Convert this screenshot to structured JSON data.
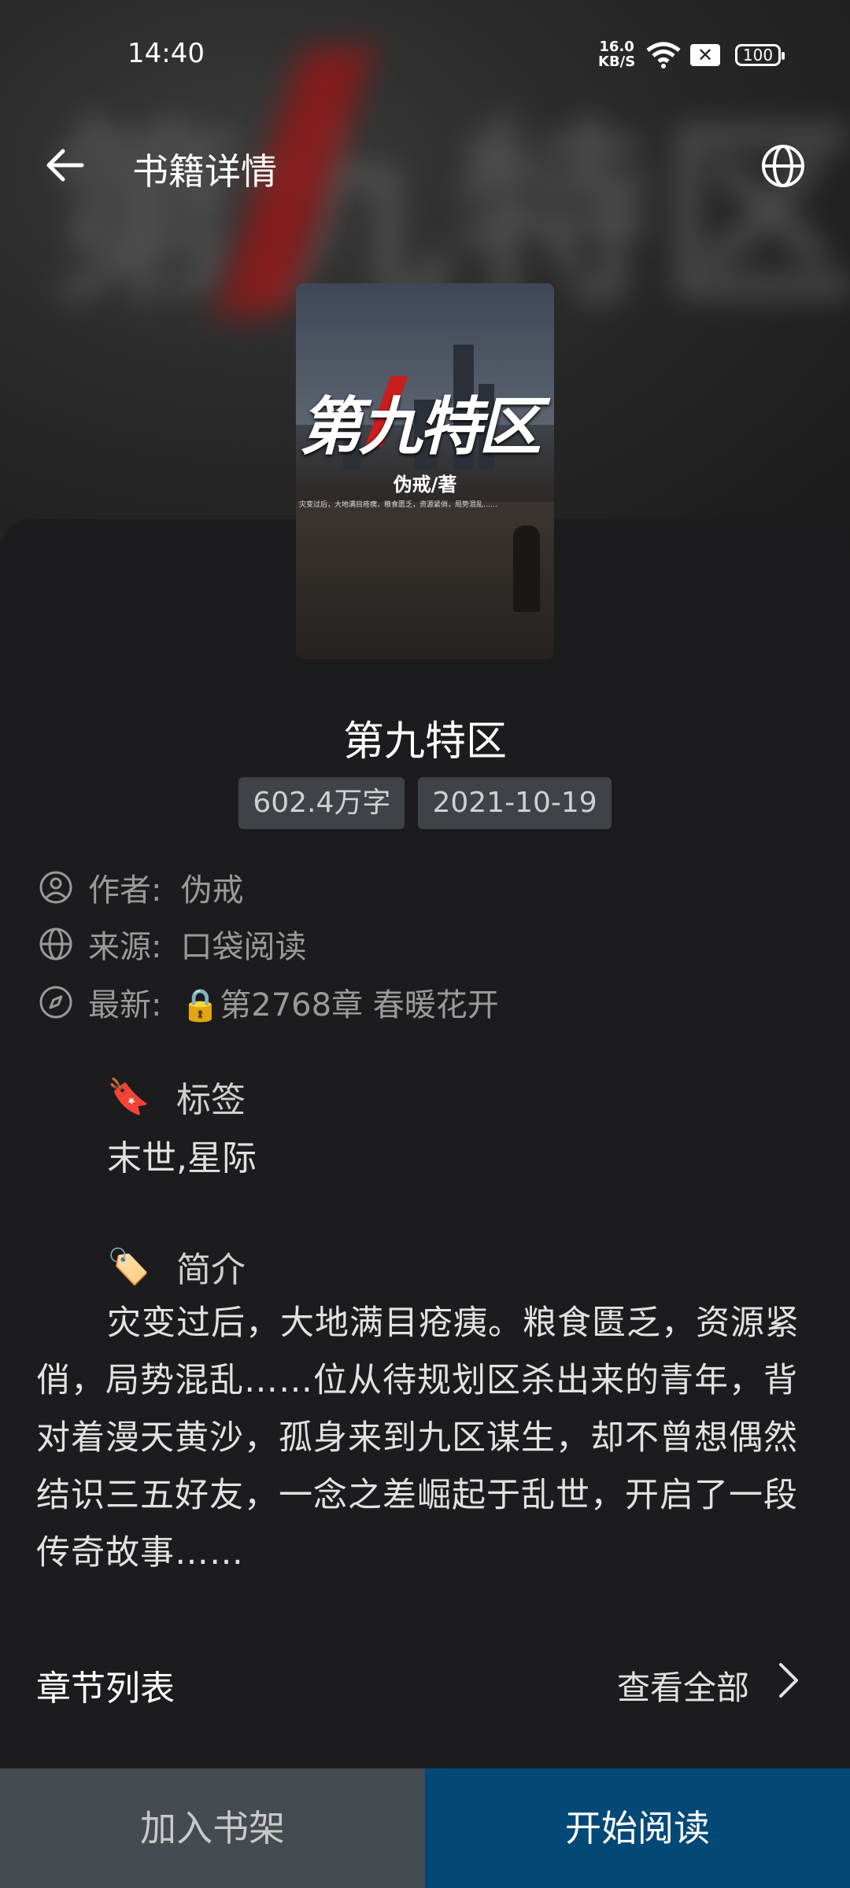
{
  "status_bar": {
    "time": "14:40",
    "net_speed_value": "16.0",
    "net_speed_unit": "KB/S",
    "battery": "100"
  },
  "header": {
    "title": "书籍详情",
    "back_icon": "arrow-left-icon",
    "globe_icon": "globe-icon"
  },
  "cover": {
    "title": "第九特区",
    "author": "伪戒/著",
    "blurb": "灾变过后，大地满目疮痍，粮食匮乏，资源紧俏，局势混乱……"
  },
  "book": {
    "title": "第九特区",
    "word_count": "602.4万字",
    "date": "2021-10-19"
  },
  "info": {
    "author_label": "作者:",
    "author_value": "伪戒",
    "source_label": "来源:",
    "source_value": "口袋阅读",
    "latest_label": "最新:",
    "latest_value": "🔒第2768章 春暖花开"
  },
  "tags": {
    "heading": "标签",
    "icon": "🔖",
    "content": "末世,星际"
  },
  "intro": {
    "heading": "简介",
    "icon": "🏷️",
    "content": "灾变过后，大地满目疮痍。粮食匮乏，资源紧俏，局势混乱……位从待规划区杀出来的青年，背对着漫天黄沙，孤身来到九区谋生，却不曾想偶然结识三五好友，一念之差崛起于乱世，开启了一段传奇故事……"
  },
  "chapters": {
    "title": "章节列表",
    "view_all": "查看全部"
  },
  "actions": {
    "add_shelf": "加入书架",
    "start_read": "开始阅读"
  },
  "colors": {
    "background": "#1c1c1e",
    "shelf_button": "#464a51",
    "read_button": "#034977",
    "chip": "#3f4247"
  }
}
